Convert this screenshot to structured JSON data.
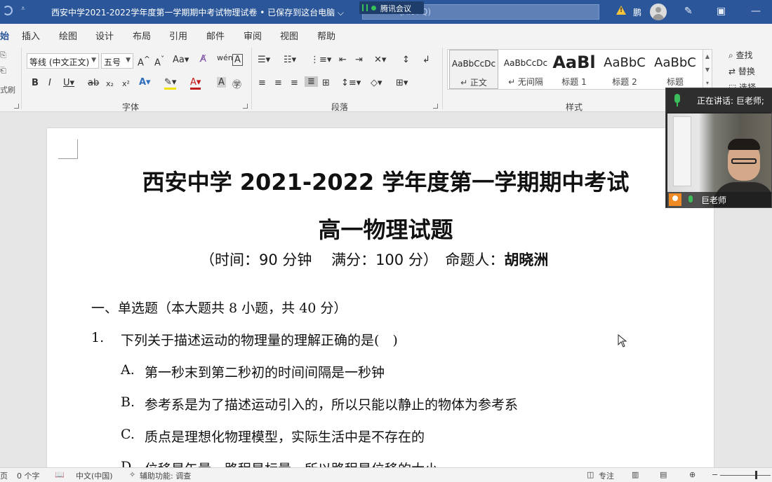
{
  "titlebar": {
    "document_title": "西安中学2021-2022学年度第一学期期中考试物理试卷 • 已保存到这台电脑 ⌵",
    "search_placeholder": "(Alt+Q)",
    "user_name_short": "鹏",
    "qat_dropdown": "⩡"
  },
  "meeting_bar": {
    "label": "腾讯会议"
  },
  "tabs": [
    "始",
    "插入",
    "绘图",
    "设计",
    "布局",
    "引用",
    "邮件",
    "审阅",
    "视图",
    "帮助"
  ],
  "ribbon": {
    "font_name": "等线 (中文正文)",
    "font_size": "五号",
    "font_group_label": "字体",
    "paragraph_group_label": "段落",
    "styles_group_label": "样式",
    "left_cut_label": "式刷",
    "styles": [
      {
        "sample": "AaBbCcDc",
        "name": "↵ 正文"
      },
      {
        "sample": "AaBbCcDc",
        "name": "↵ 无间隔"
      },
      {
        "sample": "AaBl",
        "name": "标题 1"
      },
      {
        "sample": "AaBbC",
        "name": "标题 2"
      },
      {
        "sample": "AaBbC",
        "name": "标题"
      }
    ],
    "find_label": "查找",
    "replace_label": "替换",
    "select_label": "选择"
  },
  "video": {
    "speaking_text": "正在讲话: 巨老师;",
    "participant_name": "巨老师"
  },
  "document": {
    "title_line1": "西安中学 2021-2022 学年度第一学期期中考试",
    "title_line2": "高一物理试题",
    "info_time": "（时间：90 分钟　 满分：100 分）　命题人：",
    "info_author": "胡晓洲",
    "section_heading": "一、单选题（本大题共 8 小题，共 40 分）",
    "question_number": "1.",
    "question_text": "下列关于描述运动的物理量的理解正确的是(　)",
    "options": [
      {
        "letter": "A.",
        "text": "第一秒末到第二秒初的时间间隔是一秒钟"
      },
      {
        "letter": "B.",
        "text": "参考系是为了描述运动引入的，所以只能以静止的物体为参考系"
      },
      {
        "letter": "C.",
        "text": "质点是理想化物理模型，实际生活中是不存在的"
      },
      {
        "letter": "D.",
        "text": "位移是矢量，路程是标量，所以路程是位移的大小"
      }
    ]
  },
  "status": {
    "page": "页",
    "word_count": "0 个字",
    "language": "中文(中国)",
    "accessibility": "辅助功能: 调查",
    "focus": "专注"
  },
  "colors": {
    "titlebar": "#2b579a",
    "ribbon_bg": "#f3f3f3",
    "canvas_bg": "#e6e6e6",
    "speaking_mic": "#3bbd5c"
  }
}
